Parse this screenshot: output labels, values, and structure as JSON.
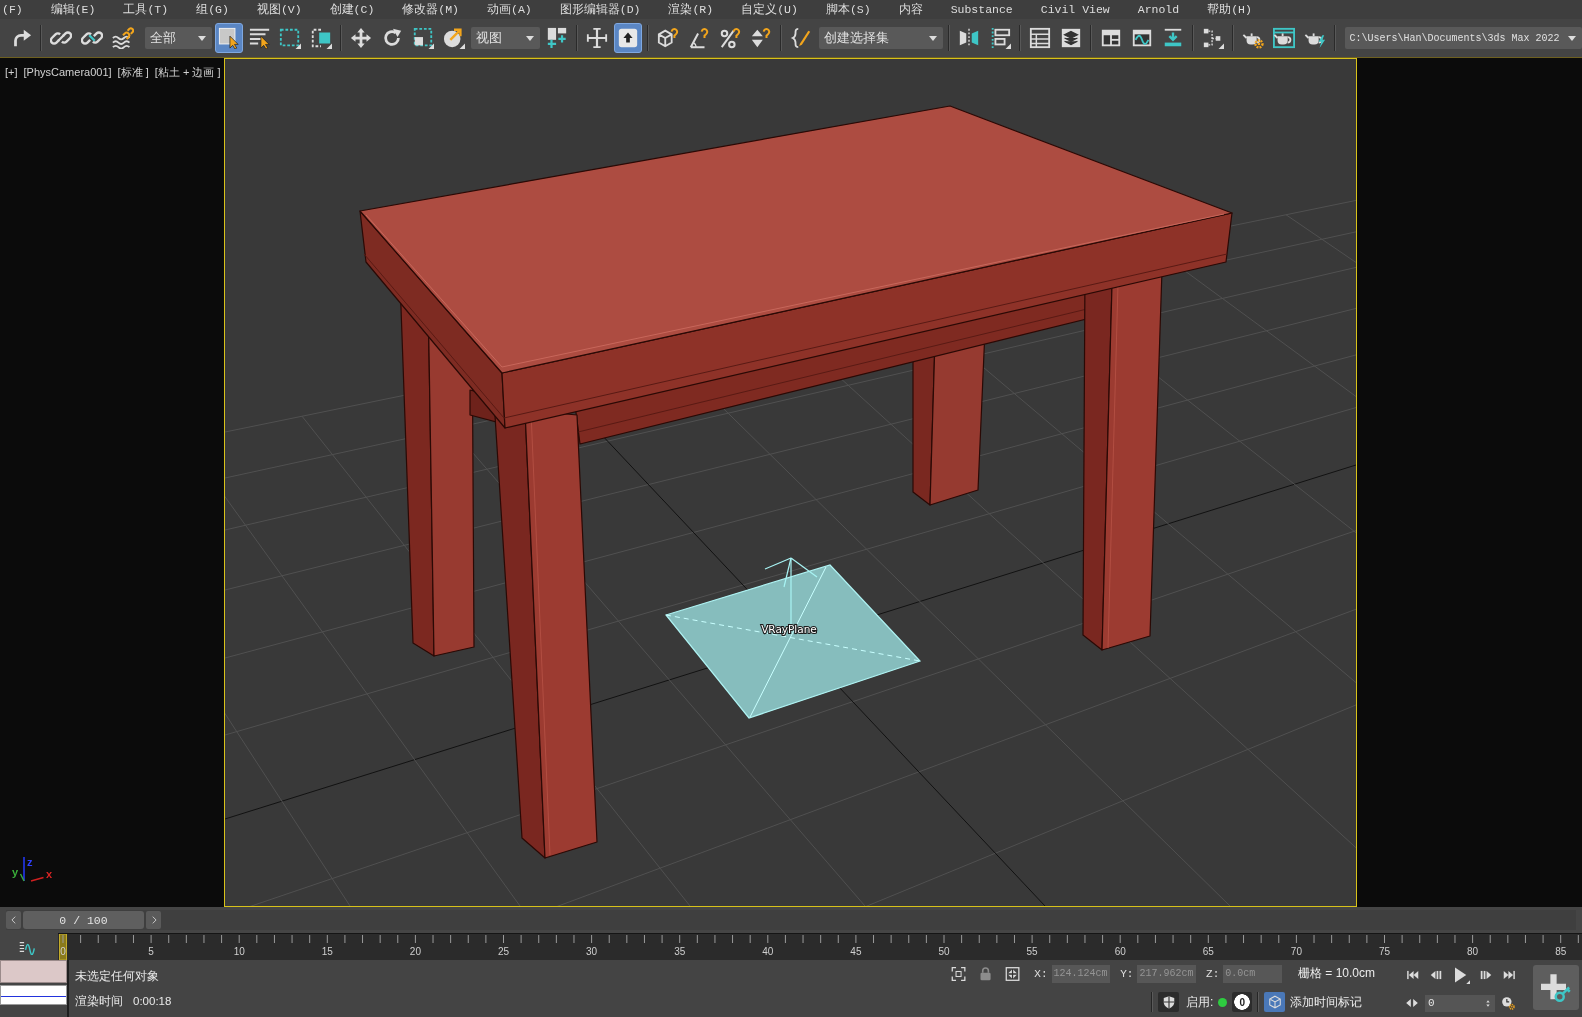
{
  "menu_bar": {
    "items": [
      "(F)",
      "编辑(E)",
      "工具(T)",
      "组(G)",
      "视图(V)",
      "创建(C)",
      "修改器(M)",
      "动画(A)",
      "图形编辑器(D)",
      "渲染(R)",
      "自定义(U)",
      "脚本(S)",
      "内容",
      "Substance",
      "Civil View",
      "Arnold",
      "帮助(H)"
    ]
  },
  "toolbar": {
    "items": [
      {
        "kind": "button",
        "on": false
      },
      {
        "kind": "separator"
      },
      {
        "kind": "button",
        "on": false
      },
      {
        "kind": "button",
        "on": false
      },
      {
        "kind": "button",
        "on": false
      },
      {
        "kind": "dropdown",
        "value": "全部"
      },
      {
        "kind": "button",
        "on": true
      },
      {
        "kind": "button",
        "on": false
      },
      {
        "kind": "button",
        "on": false
      },
      {
        "kind": "button",
        "on": false
      },
      {
        "kind": "separator"
      },
      {
        "kind": "button",
        "on": false
      },
      {
        "kind": "button",
        "on": false
      },
      {
        "kind": "button",
        "on": false
      },
      {
        "kind": "button",
        "on": false
      },
      {
        "kind": "dropdown",
        "value": "视图"
      },
      {
        "kind": "button",
        "on": false
      },
      {
        "kind": "separator"
      },
      {
        "kind": "button",
        "on": false
      },
      {
        "kind": "button",
        "on": true
      },
      {
        "kind": "separator"
      },
      {
        "kind": "button",
        "on": false
      },
      {
        "kind": "button",
        "on": false
      },
      {
        "kind": "button",
        "on": false
      },
      {
        "kind": "button",
        "on": false
      },
      {
        "kind": "separator"
      },
      {
        "kind": "button",
        "on": false
      },
      {
        "kind": "dropdown",
        "value": "创建选择集"
      },
      {
        "kind": "separator"
      },
      {
        "kind": "button",
        "on": false
      },
      {
        "kind": "button",
        "on": false
      },
      {
        "kind": "separator"
      },
      {
        "kind": "button",
        "on": false
      },
      {
        "kind": "button",
        "on": false
      },
      {
        "kind": "separator"
      },
      {
        "kind": "button",
        "on": false
      },
      {
        "kind": "button",
        "on": false
      },
      {
        "kind": "button",
        "on": false
      },
      {
        "kind": "separator"
      },
      {
        "kind": "button",
        "on": false
      },
      {
        "kind": "separator"
      },
      {
        "kind": "button",
        "on": false
      },
      {
        "kind": "button",
        "on": false
      },
      {
        "kind": "button",
        "on": false
      },
      {
        "kind": "separator"
      },
      {
        "kind": "dropdown",
        "value": "C:\\Users\\Han\\Documents\\3ds Max 2022"
      }
    ]
  },
  "viewport": {
    "labels": [
      "[+]",
      "[PhysCamera001]",
      "[标准 ]",
      "[粘土 + 边画 ]"
    ],
    "object_label": "VRayPlane",
    "axis_labels": [
      "z",
      "y",
      "x"
    ]
  },
  "time_slider": {
    "value": "0 / 100",
    "level": 0
  },
  "timeline": {
    "labels": [
      "0",
      "5",
      "10",
      "15",
      "20",
      "25",
      "30",
      "35",
      "40",
      "45",
      "50",
      "55",
      "60",
      "65",
      "70",
      "75",
      "80",
      "85"
    ]
  },
  "status_bar": {
    "prompt": "未选定任何对象",
    "render_time_label": "渲染时间",
    "render_time": "0:00:18",
    "coordinates": [
      {
        "axis": "X:",
        "value": "124.124cm",
        "disabled": true
      },
      {
        "axis": "Y:",
        "value": "217.962cm",
        "disabled": true
      },
      {
        "axis": "Z:",
        "value": "0.0cm",
        "disabled": true
      }
    ],
    "grid": "栅格 = 10.0cm",
    "enable_label": "启用:",
    "enabled": true,
    "counter": "0",
    "time_tag": "添加时间标记",
    "frame": "0"
  }
}
